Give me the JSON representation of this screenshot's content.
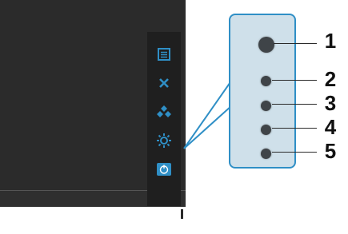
{
  "colors": {
    "menu_icon_blue": "#2f8fc6",
    "screen_dark": "#2b2b2b",
    "panel_fill": "#cfe0ea",
    "panel_border": "#2f8fc6"
  },
  "menu_icons": [
    "menu-icon",
    "close-icon",
    "input-source-icon",
    "brightness-icon",
    "power-icon"
  ],
  "callouts": [
    {
      "label": "1"
    },
    {
      "label": "2"
    },
    {
      "label": "3"
    },
    {
      "label": "4"
    },
    {
      "label": "5"
    }
  ]
}
